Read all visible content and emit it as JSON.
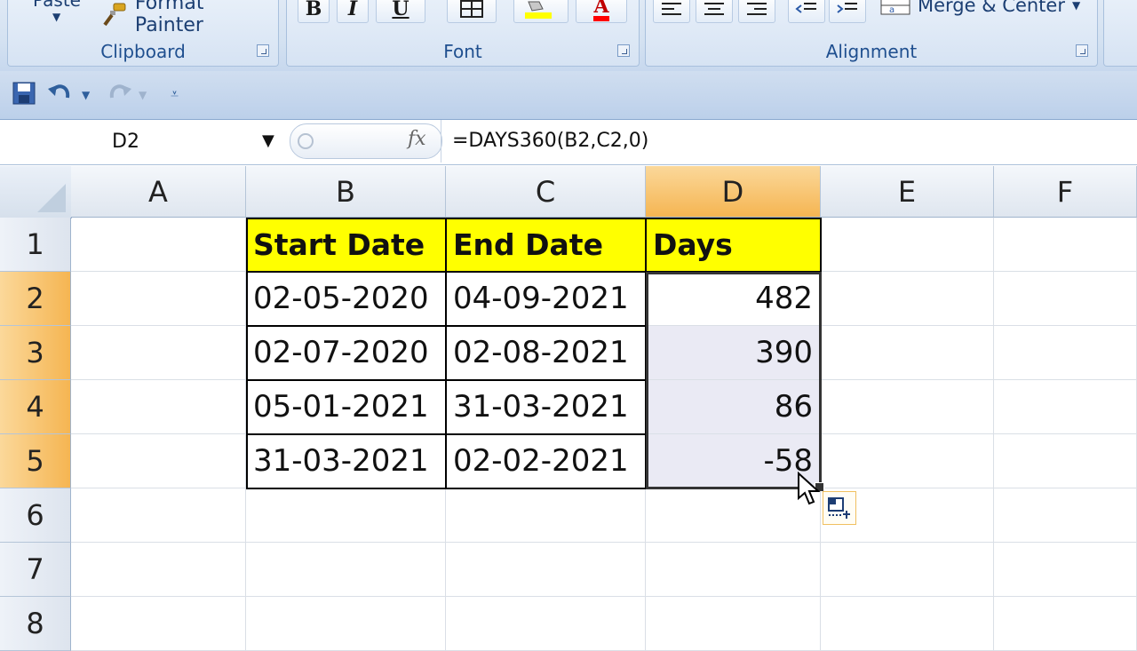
{
  "ribbon": {
    "paste_label": "Paste",
    "format_painter_label": "Format Painter",
    "clipboard_label": "Clipboard",
    "font_label": "Font",
    "alignment_label": "Alignment",
    "merge_label": "Merge & Center",
    "bold_label": "B",
    "italic_label": "I",
    "underline_label": "U",
    "font_color_label": "A"
  },
  "formula_bar": {
    "name_box": "D2",
    "fx_label": "fx",
    "formula": "=DAYS360(B2,C2,0)"
  },
  "columns": [
    "A",
    "B",
    "C",
    "D",
    "E",
    "F"
  ],
  "rows": [
    "1",
    "2",
    "3",
    "4",
    "5",
    "6",
    "7",
    "8"
  ],
  "table": {
    "headers": [
      "Start Date",
      "End Date",
      "Days"
    ],
    "rows": [
      [
        "02-05-2020",
        "04-09-2021",
        "482"
      ],
      [
        "02-07-2020",
        "02-08-2021",
        "390"
      ],
      [
        "05-01-2021",
        "31-03-2021",
        "86"
      ],
      [
        "31-03-2021",
        "02-02-2021",
        "-58"
      ]
    ]
  },
  "colors": {
    "header_fill": "#ffff00",
    "selected_header": "#f5b552",
    "ribbon_text": "#1f4f8f"
  }
}
